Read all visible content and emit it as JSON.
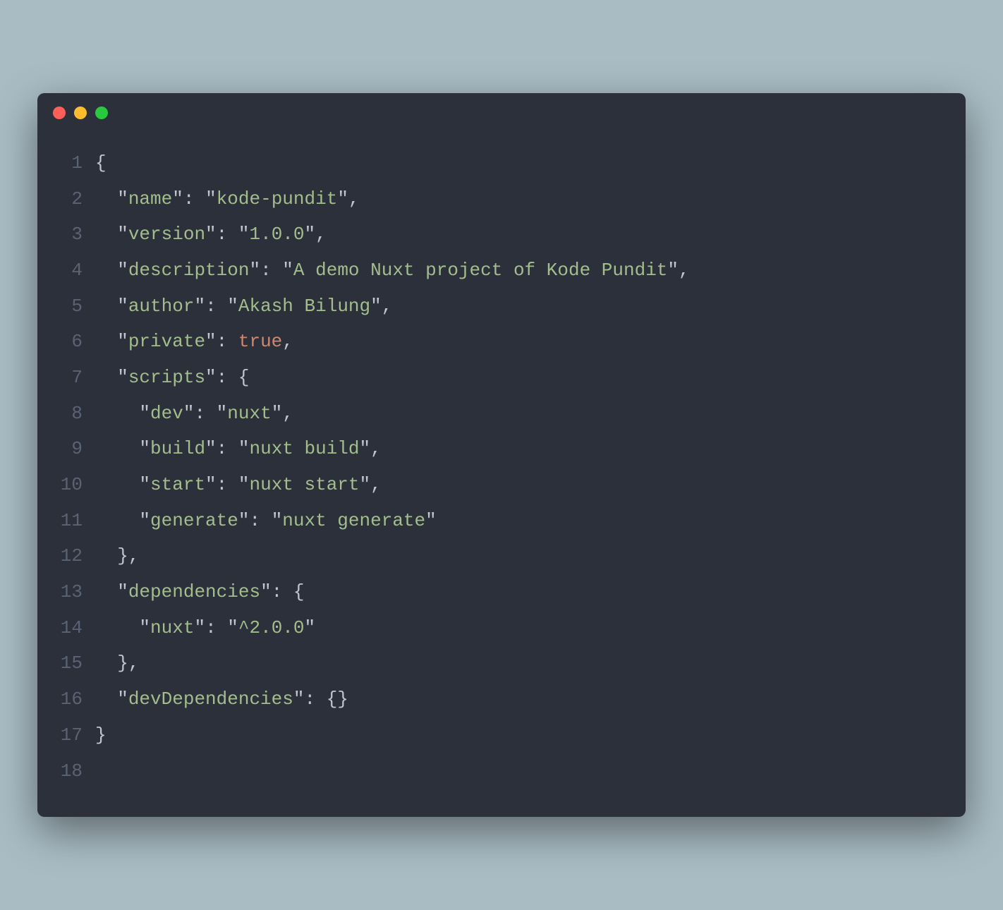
{
  "lineNumbers": [
    "1",
    "2",
    "3",
    "4",
    "5",
    "6",
    "7",
    "8",
    "9",
    "10",
    "11",
    "12",
    "13",
    "14",
    "15",
    "16",
    "17",
    "18"
  ],
  "colors": {
    "background": "#a9bcc4",
    "editor": "#2b303b",
    "punctuation": "#c0c5ce",
    "string": "#a3be8c",
    "boolean": "#d08770",
    "lineNumber": "#5a6374",
    "dotRed": "#ff5f56",
    "dotYellow": "#ffbd2e",
    "dotGreen": "#27c93f"
  },
  "json": {
    "name": "kode-pundit",
    "version": "1.0.0",
    "description": "A demo Nuxt project of Kode Pundit",
    "author": "Akash Bilung",
    "private": true,
    "scripts": {
      "dev": "nuxt",
      "build": "nuxt build",
      "start": "nuxt start",
      "generate": "nuxt generate"
    },
    "dependencies": {
      "nuxt": "^2.0.0"
    },
    "devDependencies": {}
  },
  "tokens": {
    "brace_open": "{",
    "brace_close": "}",
    "brace_close_comma": "},",
    "q": "\"",
    "colon_sp": ": ",
    "comma": ",",
    "empty_obj": "{}",
    "indent1": "  ",
    "indent2": "    ",
    "key_name": "name",
    "key_version": "version",
    "key_description": "description",
    "key_author": "author",
    "key_private": "private",
    "key_scripts": "scripts",
    "key_dev": "dev",
    "key_build": "build",
    "key_start": "start",
    "key_generate": "generate",
    "key_dependencies": "dependencies",
    "key_nuxt": "nuxt",
    "key_devDependencies": "devDependencies",
    "val_true": "true"
  }
}
